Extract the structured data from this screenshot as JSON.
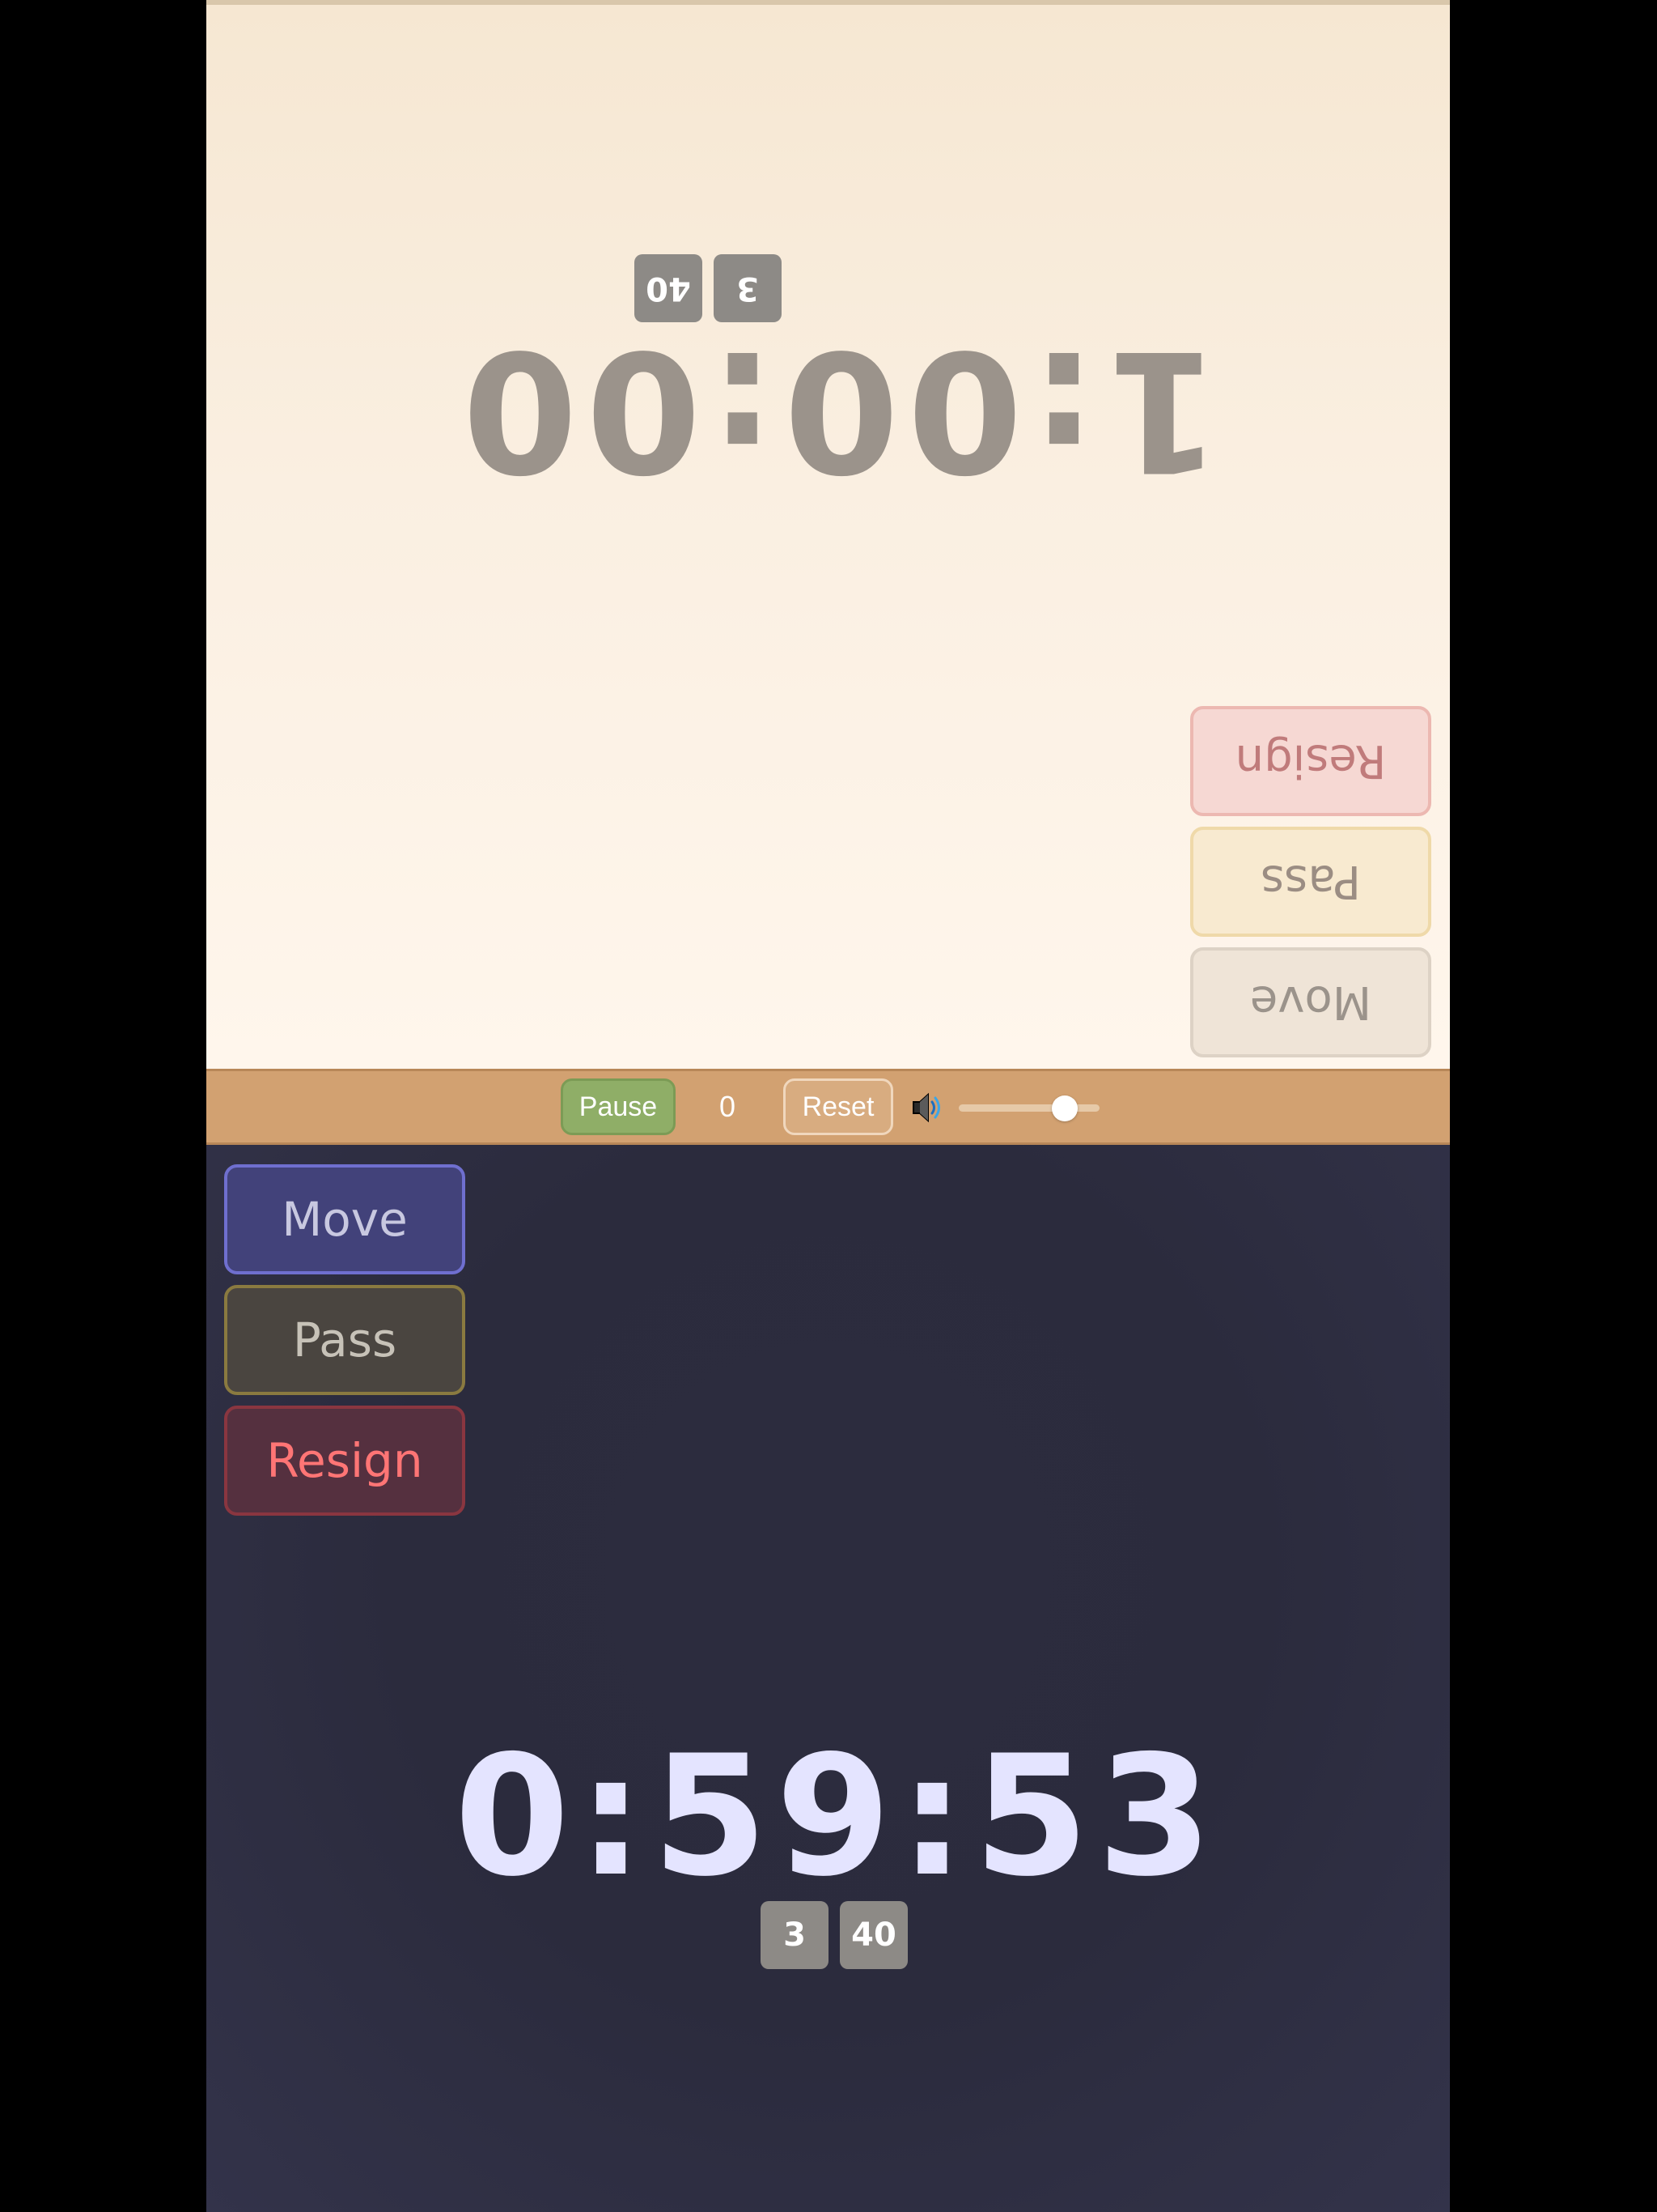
{
  "top_player": {
    "clock": "1:00:00",
    "badge_a": "3",
    "badge_b": "40",
    "buttons": {
      "move": "Move",
      "pass": "Pass",
      "resign": "Resign"
    }
  },
  "toolbar": {
    "pause_label": "Pause",
    "counter": "0",
    "reset_label": "Reset",
    "volume_level": 0.75
  },
  "bottom_player": {
    "clock": "0:59:53",
    "badge_a": "3",
    "badge_b": "40",
    "buttons": {
      "move": "Move",
      "pass": "Pass",
      "resign": "Resign"
    }
  },
  "colors": {
    "top_bg": "#faefe1",
    "bottom_bg": "#2b2b3d",
    "toolbar_bg": "#d2a171",
    "pause_green": "#8fae67",
    "resign_red": "#ff7575"
  }
}
